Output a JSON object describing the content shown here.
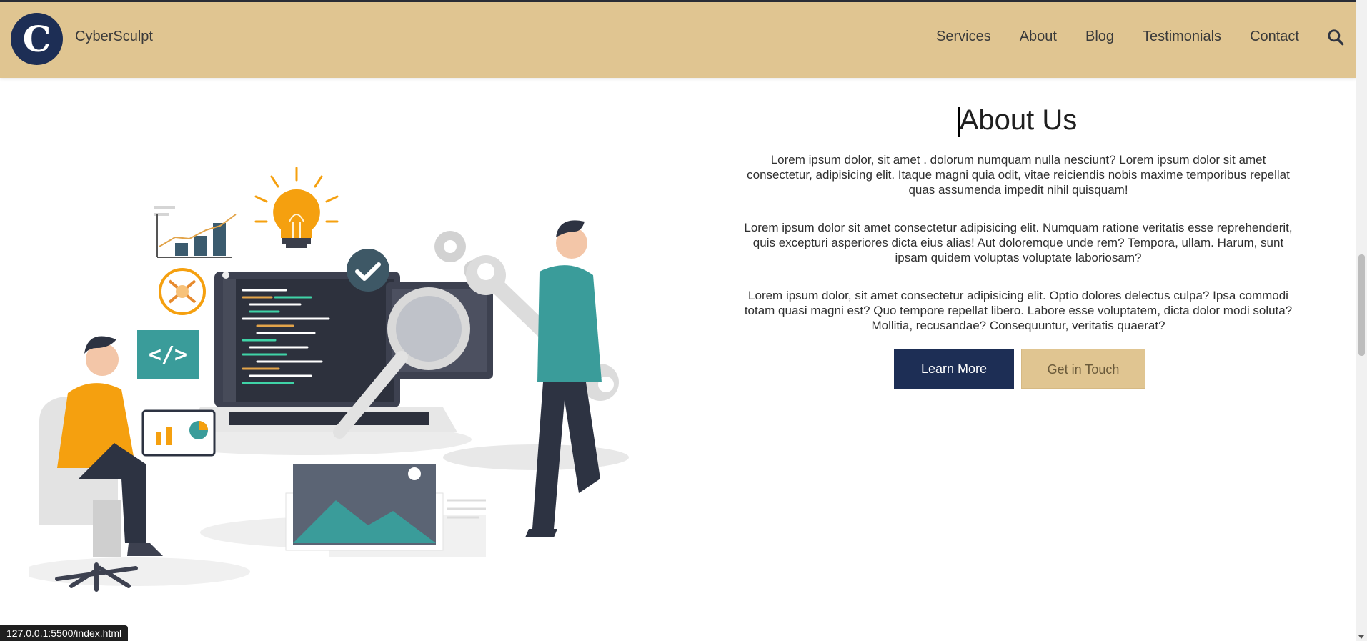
{
  "navbar": {
    "logo_letter": "C",
    "brand": "CyberSculpt",
    "links": [
      "Services",
      "About",
      "Blog",
      "Testimonials",
      "Contact"
    ],
    "search_icon": "search-icon"
  },
  "about": {
    "title": "About Us",
    "paragraphs": [
      "Lorem ipsum dolor, sit amet . dolorum numquam nulla nesciunt? Lorem ipsum dolor sit amet consectetur, adipisicing elit. Itaque magni quia odit, vitae reiciendis nobis maxime temporibus repellat quas assumenda impedit nihil quisquam!",
      "Lorem ipsum dolor sit amet consectetur adipisicing elit. Numquam ratione veritatis esse reprehenderit, quis excepturi asperiores dicta eius alias! Aut doloremque unde rem? Tempora, ullam. Harum, sunt ipsam quidem voluptas voluptate laboriosam?",
      "Lorem ipsum dolor, sit amet consectetur adipisicing elit. Optio dolores delectus culpa? Ipsa commodi totam quasi magni est? Quo tempore repellat libero. Labore esse voluptatem, dicta dolor modi soluta? Mollitia, recusandae? Consequuntur, veritatis quaerat?"
    ],
    "learn_more": "Learn More",
    "get_in_touch": "Get in Touch"
  },
  "illustration": {
    "code_tag": "</>"
  },
  "status_bar": {
    "url": "127.0.0.1:5500/index.html"
  },
  "colors": {
    "navbar_bg": "#e0c591",
    "primary": "#1d2e55",
    "teal": "#3a9c9a",
    "accent_orange": "#f5a00f"
  }
}
